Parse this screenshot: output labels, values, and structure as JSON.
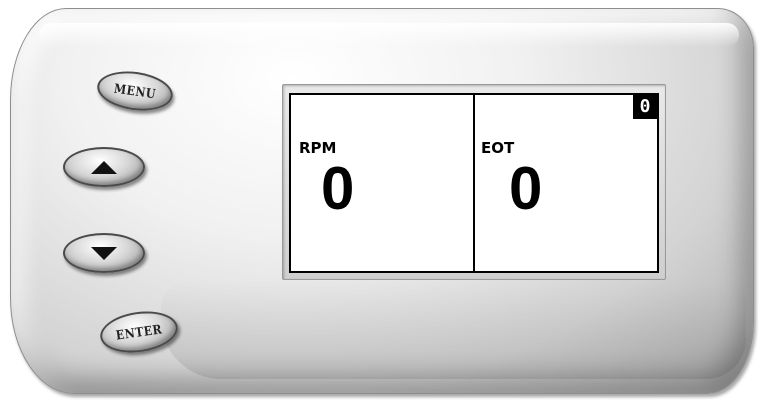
{
  "buttons": {
    "menu_label": "MENU",
    "up_icon": "triangle-up-icon",
    "down_icon": "triangle-down-icon",
    "enter_label": "ENTER"
  },
  "display": {
    "left_gauge": {
      "label": "RPM",
      "value": "0"
    },
    "right_gauge": {
      "label": "EOT",
      "value": "0"
    },
    "page_indicator": "0"
  },
  "colors": {
    "lcd_background": "#ffffff",
    "lcd_ink": "#000000",
    "housing": "#e0e0e0"
  }
}
